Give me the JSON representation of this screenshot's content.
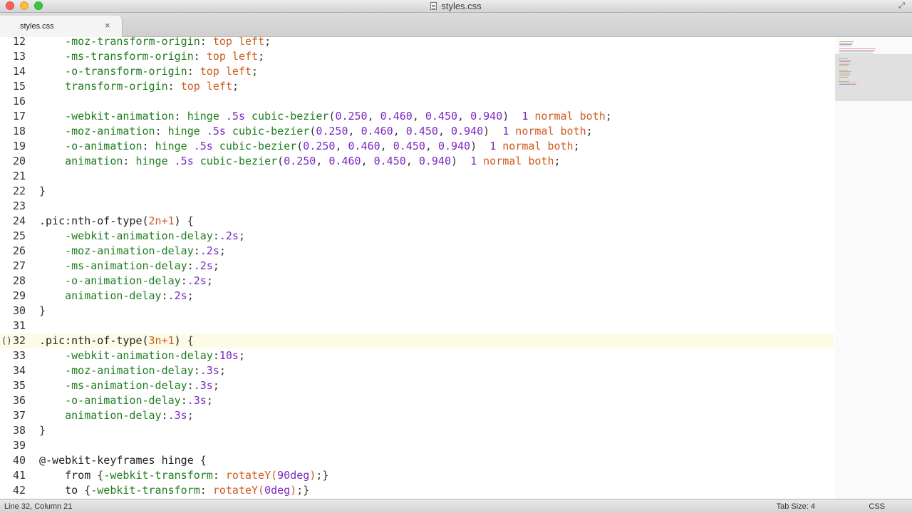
{
  "window": {
    "title": "styles.css"
  },
  "tabs": [
    {
      "label": "styles.css",
      "close_glyph": "×"
    }
  ],
  "editor": {
    "current_line": 32,
    "lines": [
      {
        "n": "12",
        "parts": [
          [
            "punc",
            "    "
          ],
          [
            "prop",
            "-moz-transform-origin"
          ],
          [
            "punc",
            ": "
          ],
          [
            "val",
            "top left"
          ],
          [
            "punc",
            ";"
          ]
        ]
      },
      {
        "n": "13",
        "parts": [
          [
            "punc",
            "    "
          ],
          [
            "prop",
            "-ms-transform-origin"
          ],
          [
            "punc",
            ": "
          ],
          [
            "val",
            "top left"
          ],
          [
            "punc",
            ";"
          ]
        ]
      },
      {
        "n": "14",
        "parts": [
          [
            "punc",
            "    "
          ],
          [
            "prop",
            "-o-transform-origin"
          ],
          [
            "punc",
            ": "
          ],
          [
            "val",
            "top left"
          ],
          [
            "punc",
            ";"
          ]
        ]
      },
      {
        "n": "15",
        "parts": [
          [
            "punc",
            "    "
          ],
          [
            "prop",
            "transform-origin"
          ],
          [
            "punc",
            ": "
          ],
          [
            "val",
            "top left"
          ],
          [
            "punc",
            ";"
          ]
        ]
      },
      {
        "n": "16",
        "parts": []
      },
      {
        "n": "17",
        "parts": [
          [
            "punc",
            "    "
          ],
          [
            "prop",
            "-webkit-animation"
          ],
          [
            "punc",
            ": "
          ],
          [
            "prop",
            "hinge "
          ],
          [
            "num",
            ".5s"
          ],
          [
            "prop",
            " cubic-bezier"
          ],
          [
            "punc",
            "("
          ],
          [
            "num",
            "0.250"
          ],
          [
            "punc",
            ", "
          ],
          [
            "num",
            "0.460"
          ],
          [
            "punc",
            ", "
          ],
          [
            "num",
            "0.450"
          ],
          [
            "punc",
            ", "
          ],
          [
            "num",
            "0.940"
          ],
          [
            "punc",
            ")  "
          ],
          [
            "num",
            "1"
          ],
          [
            "val",
            " normal both"
          ],
          [
            "punc",
            ";"
          ]
        ]
      },
      {
        "n": "18",
        "parts": [
          [
            "punc",
            "    "
          ],
          [
            "prop",
            "-moz-animation"
          ],
          [
            "punc",
            ": "
          ],
          [
            "prop",
            "hinge "
          ],
          [
            "num",
            ".5s"
          ],
          [
            "prop",
            " cubic-bezier"
          ],
          [
            "punc",
            "("
          ],
          [
            "num",
            "0.250"
          ],
          [
            "punc",
            ", "
          ],
          [
            "num",
            "0.460"
          ],
          [
            "punc",
            ", "
          ],
          [
            "num",
            "0.450"
          ],
          [
            "punc",
            ", "
          ],
          [
            "num",
            "0.940"
          ],
          [
            "punc",
            ")  "
          ],
          [
            "num",
            "1"
          ],
          [
            "val",
            " normal both"
          ],
          [
            "punc",
            ";"
          ]
        ]
      },
      {
        "n": "19",
        "parts": [
          [
            "punc",
            "    "
          ],
          [
            "prop",
            "-o-animation"
          ],
          [
            "punc",
            ": "
          ],
          [
            "prop",
            "hinge "
          ],
          [
            "num",
            ".5s"
          ],
          [
            "prop",
            " cubic-bezier"
          ],
          [
            "punc",
            "("
          ],
          [
            "num",
            "0.250"
          ],
          [
            "punc",
            ", "
          ],
          [
            "num",
            "0.460"
          ],
          [
            "punc",
            ", "
          ],
          [
            "num",
            "0.450"
          ],
          [
            "punc",
            ", "
          ],
          [
            "num",
            "0.940"
          ],
          [
            "punc",
            ")  "
          ],
          [
            "num",
            "1"
          ],
          [
            "val",
            " normal both"
          ],
          [
            "punc",
            ";"
          ]
        ]
      },
      {
        "n": "20",
        "parts": [
          [
            "punc",
            "    "
          ],
          [
            "prop",
            "animation"
          ],
          [
            "punc",
            ": "
          ],
          [
            "prop",
            "hinge "
          ],
          [
            "num",
            ".5s"
          ],
          [
            "prop",
            " cubic-bezier"
          ],
          [
            "punc",
            "("
          ],
          [
            "num",
            "0.250"
          ],
          [
            "punc",
            ", "
          ],
          [
            "num",
            "0.460"
          ],
          [
            "punc",
            ", "
          ],
          [
            "num",
            "0.450"
          ],
          [
            "punc",
            ", "
          ],
          [
            "num",
            "0.940"
          ],
          [
            "punc",
            ")  "
          ],
          [
            "num",
            "1"
          ],
          [
            "val",
            " normal both"
          ],
          [
            "punc",
            ";"
          ]
        ]
      },
      {
        "n": "21",
        "parts": []
      },
      {
        "n": "22",
        "parts": [
          [
            "punc",
            "}"
          ]
        ]
      },
      {
        "n": "23",
        "parts": []
      },
      {
        "n": "24",
        "parts": [
          [
            "sel",
            ".pic:nth-of-type("
          ],
          [
            "val",
            "2n+1"
          ],
          [
            "sel",
            ")"
          ],
          [
            "punc",
            " {"
          ]
        ]
      },
      {
        "n": "25",
        "parts": [
          [
            "punc",
            "    "
          ],
          [
            "prop",
            "-webkit-animation-delay"
          ],
          [
            "punc",
            ":"
          ],
          [
            "num",
            ".2s"
          ],
          [
            "punc",
            ";"
          ]
        ]
      },
      {
        "n": "26",
        "parts": [
          [
            "punc",
            "    "
          ],
          [
            "prop",
            "-moz-animation-delay"
          ],
          [
            "punc",
            ":"
          ],
          [
            "num",
            ".2s"
          ],
          [
            "punc",
            ";"
          ]
        ]
      },
      {
        "n": "27",
        "parts": [
          [
            "punc",
            "    "
          ],
          [
            "prop",
            "-ms-animation-delay"
          ],
          [
            "punc",
            ":"
          ],
          [
            "num",
            ".2s"
          ],
          [
            "punc",
            ";"
          ]
        ]
      },
      {
        "n": "28",
        "parts": [
          [
            "punc",
            "    "
          ],
          [
            "prop",
            "-o-animation-delay"
          ],
          [
            "punc",
            ":"
          ],
          [
            "num",
            ".2s"
          ],
          [
            "punc",
            ";"
          ]
        ]
      },
      {
        "n": "29",
        "parts": [
          [
            "punc",
            "    "
          ],
          [
            "prop",
            "animation-delay"
          ],
          [
            "punc",
            ":"
          ],
          [
            "num",
            ".2s"
          ],
          [
            "punc",
            ";"
          ]
        ]
      },
      {
        "n": "30",
        "parts": [
          [
            "punc",
            "}"
          ]
        ]
      },
      {
        "n": "31",
        "parts": []
      },
      {
        "n": "32",
        "marker": "()",
        "parts": [
          [
            "sel",
            ".pic:nth-of-type("
          ],
          [
            "val",
            "3n+1"
          ],
          [
            "sel",
            ")"
          ],
          [
            "punc",
            " {"
          ]
        ]
      },
      {
        "n": "33",
        "parts": [
          [
            "punc",
            "    "
          ],
          [
            "prop",
            "-webkit-animation-delay"
          ],
          [
            "punc",
            ":"
          ],
          [
            "num",
            "10s"
          ],
          [
            "punc",
            ";"
          ]
        ]
      },
      {
        "n": "34",
        "parts": [
          [
            "punc",
            "    "
          ],
          [
            "prop",
            "-moz-animation-delay"
          ],
          [
            "punc",
            ":"
          ],
          [
            "num",
            ".3s"
          ],
          [
            "punc",
            ";"
          ]
        ]
      },
      {
        "n": "35",
        "parts": [
          [
            "punc",
            "    "
          ],
          [
            "prop",
            "-ms-animation-delay"
          ],
          [
            "punc",
            ":"
          ],
          [
            "num",
            ".3s"
          ],
          [
            "punc",
            ";"
          ]
        ]
      },
      {
        "n": "36",
        "parts": [
          [
            "punc",
            "    "
          ],
          [
            "prop",
            "-o-animation-delay"
          ],
          [
            "punc",
            ":"
          ],
          [
            "num",
            ".3s"
          ],
          [
            "punc",
            ";"
          ]
        ]
      },
      {
        "n": "37",
        "parts": [
          [
            "punc",
            "    "
          ],
          [
            "prop",
            "animation-delay"
          ],
          [
            "punc",
            ":"
          ],
          [
            "num",
            ".3s"
          ],
          [
            "punc",
            ";"
          ]
        ]
      },
      {
        "n": "38",
        "parts": [
          [
            "punc",
            "}"
          ]
        ]
      },
      {
        "n": "39",
        "parts": []
      },
      {
        "n": "40",
        "parts": [
          [
            "sel",
            "@-webkit-keyframes hinge"
          ],
          [
            "punc",
            " {"
          ]
        ]
      },
      {
        "n": "41",
        "parts": [
          [
            "punc",
            "    "
          ],
          [
            "sel",
            "from "
          ],
          [
            "punc",
            "{"
          ],
          [
            "prop",
            "-webkit-transform"
          ],
          [
            "punc",
            ": "
          ],
          [
            "val",
            "rotateY("
          ],
          [
            "num",
            "90deg"
          ],
          [
            "val",
            ")"
          ],
          [
            "punc",
            ";}"
          ]
        ]
      },
      {
        "n": "42",
        "parts": [
          [
            "punc",
            "    "
          ],
          [
            "sel",
            "to "
          ],
          [
            "punc",
            "{"
          ],
          [
            "prop",
            "-webkit-transform"
          ],
          [
            "punc",
            ": "
          ],
          [
            "val",
            "rotateY("
          ],
          [
            "num",
            "0deg"
          ],
          [
            "val",
            ")"
          ],
          [
            "punc",
            ";}"
          ]
        ]
      }
    ]
  },
  "status": {
    "position": "Line 32, Column 21",
    "tab_size": "Tab Size: 4",
    "syntax": "CSS"
  },
  "colors": {
    "property": "#1f7d1f",
    "value": "#cf5b1e",
    "number": "#7a28c0",
    "selector": "#222222",
    "current_line_bg": "#fbfbe6"
  },
  "icons": {
    "document": "document-icon",
    "fullscreen": "fullscreen-icon"
  }
}
